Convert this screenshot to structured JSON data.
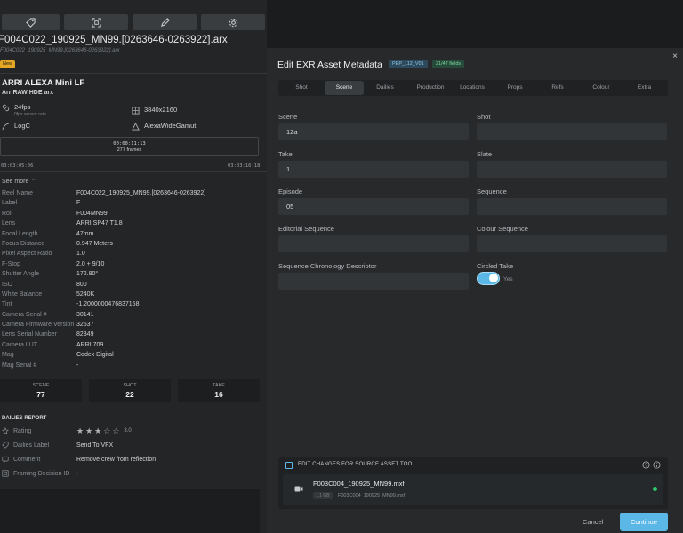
{
  "left": {
    "toolbar": [
      {
        "name": "tag-icon"
      },
      {
        "name": "scan-icon"
      },
      {
        "name": "pencil-icon"
      },
      {
        "name": "gear-icon"
      }
    ],
    "asset_title": "F004C022_190925_MN99.[0263646-0263922].arx",
    "asset_subtitle": "F004C022_190925_MN99.[0263646-0263922].arx",
    "badge": "New",
    "camera_name": "ARRI ALEXA Mini LF",
    "camera_format": "ArriRAW HDE arx",
    "specs": {
      "fps": "24fps",
      "fps_sub": "0fps sensor rate",
      "resolution": "3840x2160",
      "log": "LogC",
      "gamut": "AlexaWideGamut"
    },
    "timecode_duration": "00:00:11:13",
    "timecode_frames": "277 frames",
    "tc_start": "03:03:05:06",
    "tc_end": "03:03:16:18",
    "see_more": "See more",
    "metadata": [
      {
        "k": "Reel Name",
        "v": "F004C022_190925_MN99.[0263646-0263922]"
      },
      {
        "k": "Label",
        "v": "F"
      },
      {
        "k": "Roll",
        "v": "F004MN99"
      },
      {
        "k": "Lens",
        "v": "ARRI SP47 T1.8"
      },
      {
        "k": "Focal Length",
        "v": "47mm"
      },
      {
        "k": "Focus Distance",
        "v": "0.947 Meters"
      },
      {
        "k": "Pixel Aspect Ratio",
        "v": "1.0"
      },
      {
        "k": "F-Stop",
        "v": "2.0 + 9/10"
      },
      {
        "k": "Shutter Angle",
        "v": "172.80°"
      },
      {
        "k": "ISO",
        "v": "800"
      },
      {
        "k": "White Balance",
        "v": "5240K"
      },
      {
        "k": "Tint",
        "v": "-1.2000000476837158"
      },
      {
        "k": "Camera Serial #",
        "v": "30141"
      },
      {
        "k": "Camera Firmware Version",
        "v": "32537"
      },
      {
        "k": "Lens Serial Number",
        "v": "82349"
      },
      {
        "k": "Camera LUT",
        "v": "ARRI 709"
      },
      {
        "k": "Mag",
        "v": "Codex Digital"
      },
      {
        "k": "Mag Serial #",
        "v": "-"
      }
    ],
    "counts": [
      {
        "label": "SCENE",
        "value": "77"
      },
      {
        "label": "SHOT",
        "value": "22"
      },
      {
        "label": "TAKE",
        "value": "16"
      }
    ],
    "dailies": {
      "title": "DAILIES REPORT",
      "rating_label": "Rating",
      "rating_value": 3,
      "rating_max": 5,
      "rating_text": "3.0",
      "label_label": "Dailies Label",
      "label_value": "Send To VFX",
      "comment_label": "Comment",
      "comment_value": "Remove crew from reflection",
      "framing_label": "Framing Decision ID",
      "framing_value": "-"
    }
  },
  "modal": {
    "title": "Edit EXR Asset Metadata",
    "version_pill": "PEP_112_V01",
    "fields_pill": "21/47 fields",
    "close": "×",
    "tabs": [
      "Shot",
      "Scene",
      "Dailies",
      "Production",
      "Locations",
      "Props",
      "Refs",
      "Colour",
      "Extra"
    ],
    "active_tab": "Scene",
    "fields": {
      "scene_label": "Scene",
      "scene_value": "12a",
      "shot_label": "Shot",
      "shot_value": "",
      "take_label": "Take",
      "take_value": "1",
      "slate_label": "Slate",
      "slate_value": "",
      "episode_label": "Episode",
      "episode_value": "05",
      "sequence_label": "Sequence",
      "sequence_value": "",
      "editorial_label": "Editorial Sequence",
      "editorial_value": "",
      "colour_seq_label": "Colour Sequence",
      "colour_seq_value": "",
      "chrono_label": "Sequence Chronology Descriptor",
      "chrono_value": "",
      "circled_label": "Circled Take",
      "circled_value": "Yes"
    },
    "source": {
      "label": "EDIT CHANGES FOR SOURCE ASSET TOO",
      "name": "F003C004_190925_MN99.mxf",
      "size": "1.1 GB",
      "file": "F003C004_190925_MN99.mxf",
      "status_color": "#2ecc71"
    },
    "cancel": "Cancel",
    "continue": "Continue"
  },
  "colors": {
    "accent": "#5bb8e6",
    "badge": "#e5a623",
    "status": "#2ecc71"
  }
}
